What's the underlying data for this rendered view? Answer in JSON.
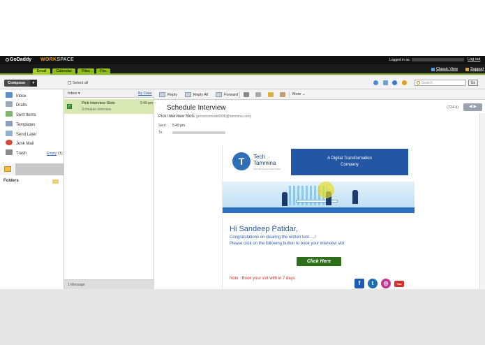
{
  "header": {
    "logo": "GoDaddy",
    "brand_ws": "WORK",
    "brand_space": "SPACE",
    "logged_in_label": "Logged in as:",
    "logout": "Log out",
    "classic_view": "Classic View",
    "support": "Support"
  },
  "tabs": [
    "Email",
    "Calendar",
    "Files",
    "Fav."
  ],
  "toolbar": {
    "compose": "Compose",
    "select_all": "Select all",
    "search_placeholder": "Search",
    "go": "Go"
  },
  "folders": [
    {
      "label": "Inbox",
      "color": "#5b8fd0"
    },
    {
      "label": "Drafts",
      "color": "#9aa8b8"
    },
    {
      "label": "Sent Items",
      "color": "#7db86a"
    },
    {
      "label": "Templates",
      "color": "#8aa0c0"
    },
    {
      "label": "Send Later",
      "color": "#8fb0d8"
    },
    {
      "label": "Junk Mail",
      "color": "#d94b3c"
    },
    {
      "label": "Trash",
      "color": "#8b8b8b"
    }
  ],
  "trash_empty": "Empty",
  "trash_count": "(1)",
  "folders_heading": "Folders",
  "message_list": {
    "folder": "Inbox ▾",
    "sort": "By Date",
    "message": {
      "subject": "Pick Interview Slots",
      "time": "5:49 pm",
      "preview": "Schedule Interview"
    },
    "count": "1 Message"
  },
  "reader": {
    "actions": [
      "Reply",
      "Reply All",
      "Forward"
    ],
    "more": "More ⌄",
    "subject": "Schedule Interview",
    "size": "(724 k)",
    "from_name": "Pick Interview Slots",
    "from_addr": "(processmode6808@tammina.com)",
    "sent_label": "Sent:",
    "sent_value": "5:49 pm",
    "to_label": "To:"
  },
  "email": {
    "logo_letter": "T",
    "brand_line1": "Tech",
    "brand_line2": "Tammina",
    "brand_tag": "Tech Tammina private limited",
    "banner_line1": "A Digital Transformation",
    "banner_line2": "Company",
    "greeting": "Hi Sandeep Patidar,",
    "line1": "Congratulations on clearing the written test.....!",
    "line2": "Please click on the following button to book your interview slot",
    "button": "Click Here",
    "note": "Note : Book your slot with in 7 days",
    "social": {
      "fb": "f",
      "tw": "t",
      "ig": "◎",
      "yt": "You"
    }
  }
}
